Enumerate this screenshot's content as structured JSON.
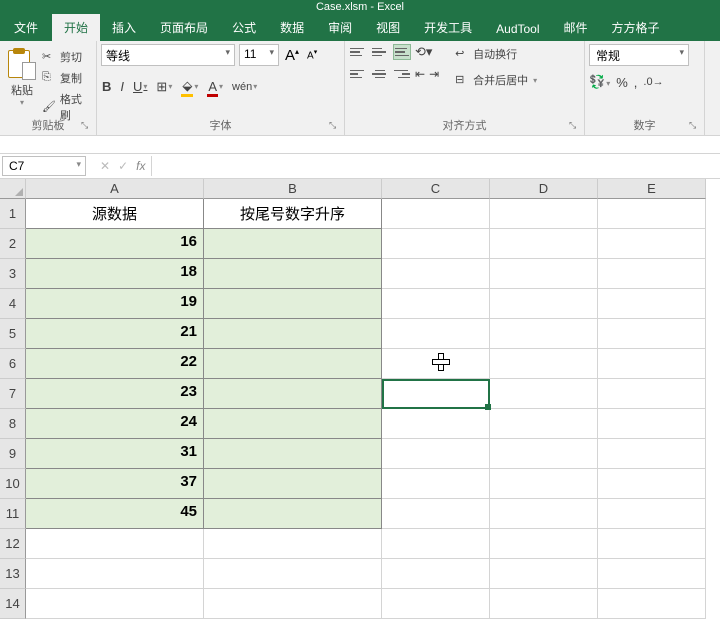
{
  "window": {
    "title": "Case.xlsm - Excel"
  },
  "tabs": {
    "file": "文件",
    "home": "开始",
    "insert": "插入",
    "page_layout": "页面布局",
    "formulas": "公式",
    "data": "数据",
    "review": "审阅",
    "view": "视图",
    "developer": "开发工具",
    "audtool": "AudTool",
    "mail": "邮件",
    "square": "方方格子"
  },
  "ribbon": {
    "clipboard": {
      "label": "剪贴板",
      "paste": "粘贴",
      "cut": "剪切",
      "copy": "复制",
      "format_painter": "格式刷"
    },
    "font": {
      "label": "字体",
      "name": "等线",
      "size": "11",
      "wen": "wén"
    },
    "alignment": {
      "label": "对齐方式",
      "wrap": "自动换行",
      "merge": "合并后居中"
    },
    "number": {
      "label": "数字",
      "format": "常规"
    }
  },
  "name_box": "C7",
  "sheet": {
    "columns": [
      "A",
      "B",
      "C",
      "D",
      "E"
    ],
    "row_numbers": [
      "1",
      "2",
      "3",
      "4",
      "5",
      "6",
      "7",
      "8",
      "9",
      "10",
      "11",
      "12",
      "13",
      "14"
    ],
    "header_a": "源数据",
    "header_b": "按尾号数字升序",
    "data_a": [
      "16",
      "18",
      "19",
      "21",
      "22",
      "23",
      "24",
      "31",
      "37",
      "45"
    ]
  },
  "chart_data": {
    "type": "table",
    "columns": [
      "源数据",
      "按尾号数字升序"
    ],
    "rows": [
      [
        16,
        null
      ],
      [
        18,
        null
      ],
      [
        19,
        null
      ],
      [
        21,
        null
      ],
      [
        22,
        null
      ],
      [
        23,
        null
      ],
      [
        24,
        null
      ],
      [
        31,
        null
      ],
      [
        37,
        null
      ],
      [
        45,
        null
      ]
    ]
  }
}
